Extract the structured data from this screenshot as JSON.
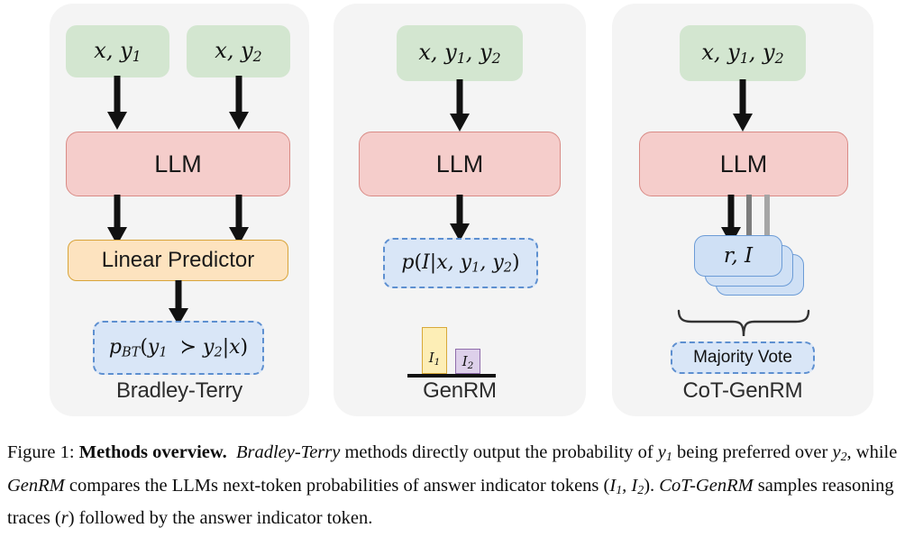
{
  "figure": {
    "panels": [
      {
        "id": "bradley-terry",
        "label": "Bradley-Terry",
        "inputs": [
          {
            "text": "x, y1",
            "base": "x, y",
            "sub": "1"
          },
          {
            "text": "x, y2",
            "base": "x, y",
            "sub": "2"
          }
        ],
        "model_label": "LLM",
        "head_label": "Linear Predictor",
        "output": "p_BT(y1 ≻ y2|x)"
      },
      {
        "id": "genrm",
        "label": "GenRM",
        "inputs": [
          {
            "text": "x, y1, y2"
          }
        ],
        "model_label": "LLM",
        "output": "p(I|x, y1, y2)",
        "bars": [
          {
            "name": "I1",
            "label": "I",
            "sub": "1",
            "value": 0.78,
            "color": "#fdeeb6",
            "border": "#d8a93a"
          },
          {
            "name": "I2",
            "label": "I",
            "sub": "2",
            "value": 0.4,
            "color": "#ddd0ea",
            "border": "#8f6cab"
          }
        ]
      },
      {
        "id": "cot-genrm",
        "label": "CoT-GenRM",
        "inputs": [
          {
            "text": "x, y1, y2"
          }
        ],
        "model_label": "LLM",
        "sample_card": "r, I",
        "sample_count": 3,
        "aggregator": "Majority Vote"
      }
    ],
    "colors": {
      "panel_bg": "#f4f4f4",
      "input_fill": "#d3e6d0",
      "llm_fill": "#f5cdcb",
      "llm_border": "#d98b86",
      "linear_fill": "#fde3bf",
      "linear_border": "#d8a43a",
      "output_fill": "#d9e6f7",
      "output_border": "#5d8fd0",
      "card_fill": "#cfe0f5",
      "card_border": "#6b9bd6",
      "arrow_primary": "#111111",
      "arrow_secondary": "#7d7d7d",
      "arrow_tertiary": "#9b9b9b",
      "bar_i1_fill": "#fdeeb6",
      "bar_i1_border": "#d8a93a",
      "bar_i2_fill": "#ddd0ea",
      "bar_i2_border": "#8f6cab"
    }
  },
  "caption": {
    "figure_number": "Figure 1:",
    "title": "Methods overview.",
    "sentence1_method": "Bradley-Terry",
    "sentence1_a": " methods directly output the probability of ",
    "sentence1_y1": "y1",
    "sentence1_b": " being preferred over ",
    "sentence1_y2": "y2",
    "sentence1_c": ", while ",
    "sentence2_method": "GenRM",
    "sentence2_a": " compares the LLMs next-token probabilities of answer indicator tokens (",
    "sentence2_tokens": "I1, I2",
    "sentence2_b": "). ",
    "sentence3_method": "CoT-GenRM",
    "sentence3_a": " samples reasoning traces (",
    "sentence3_r": "r",
    "sentence3_b": ") followed by the answer indicator token."
  }
}
